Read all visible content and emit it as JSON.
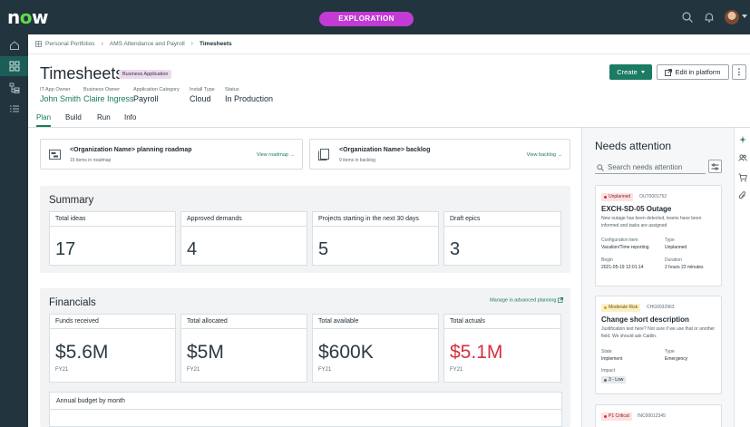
{
  "topbar": {
    "logo_text": "now",
    "env_badge": "EXPLORATION",
    "icons": [
      "search-icon",
      "bell-icon",
      "avatar",
      "caret-icon"
    ]
  },
  "leftrail": {
    "items": [
      "home-icon",
      "grid-icon",
      "hierarchy-icon",
      "list-icon"
    ]
  },
  "breadcrumb": {
    "items": [
      "Personal Portfolios",
      "AMS Attendance and Payroll",
      "Timesheets"
    ]
  },
  "header": {
    "title": "Timesheets",
    "badge": "Business Application",
    "meta": [
      {
        "label": "IT App Owner",
        "value": "John Smith"
      },
      {
        "label": "Business Owner",
        "value": "Claire Ingress"
      },
      {
        "label": "Application Category",
        "value": "Payroll"
      },
      {
        "label": "Install Type",
        "value": "Cloud"
      },
      {
        "label": "Status",
        "value": "In Production"
      }
    ],
    "create_label": "Create",
    "edit_label": "Edit in platform",
    "more_label": "⋮"
  },
  "tabs": [
    "Plan",
    "Build",
    "Run",
    "Info"
  ],
  "roadmap_cards": [
    {
      "title": "<Organization Name> planning roadmap",
      "subtitle": "15 items in roadmap",
      "link": "View roadmap →"
    },
    {
      "title": "<Organization Name> backlog",
      "subtitle": "9 items in backlog",
      "link": "View backlog →"
    }
  ],
  "summary": {
    "title": "Summary",
    "stats": [
      {
        "label": "Total ideas",
        "value": "17"
      },
      {
        "label": "Approved demands",
        "value": "4"
      },
      {
        "label": "Projects starting in the next 30 days",
        "value": "5"
      },
      {
        "label": "Draft epics",
        "value": "3"
      }
    ]
  },
  "financials": {
    "title": "Financials",
    "manage_link": "Manage in advanced planning",
    "stats": [
      {
        "label": "Funds received",
        "value": "$5.6M",
        "fy": "FY21"
      },
      {
        "label": "Total allocated",
        "value": "$5M",
        "fy": "FY21"
      },
      {
        "label": "Total available",
        "value": "$600K",
        "fy": "FY21"
      },
      {
        "label": "Total actuals",
        "value": "$5.1M",
        "fy": "FY21"
      }
    ],
    "budget_title": "Annual budget by month"
  },
  "needs_attention": {
    "title": "Needs attention",
    "search_placeholder": "Search needs attention",
    "cards": [
      {
        "tag": "Unplanned",
        "tag_color": "#fde2e3",
        "tag_dot": "#d5313d",
        "number": "OUT0001752",
        "title": "EXCH-SD-05 Outage",
        "desc": "New outage has been detected, teams have been informed and tasks are assigned",
        "f1_label": "Configuration item",
        "f1_value": "Vacation/Time reporting",
        "f2_label": "Type",
        "f2_value": "Unplanned",
        "f3_label": "Begin",
        "f3_value": "2021-05-19 12:01:14",
        "f4_label": "Duration",
        "f4_value": "2 hours 22 minutes"
      },
      {
        "tag": "Moderate Risk",
        "tag_color": "#fbf0c8",
        "tag_dot": "#d9a400",
        "number": "CHG0032963",
        "title": "Change short description",
        "desc": "Justification text here? Not sure if we use that or another field. We should ask Caitlin.",
        "f1_label": "State",
        "f1_value": "Implement",
        "f2_label": "Type",
        "f2_value": "Emergency",
        "f3_label": "Impact",
        "f3_value": "3 - Low"
      },
      {
        "tag": "P1 Critical",
        "tag_color": "#fde2e3",
        "tag_dot": "#d5313d",
        "number": "INC00012345"
      }
    ]
  },
  "rightrail": {
    "icons": [
      "sparkle-icon",
      "people-icon",
      "cart-icon",
      "paperclip-icon"
    ]
  },
  "colors": {
    "brand_green": "#1b7b63",
    "nav_dark": "#22343d",
    "exploration": "#c23bd4",
    "negative": "#d5313d"
  }
}
